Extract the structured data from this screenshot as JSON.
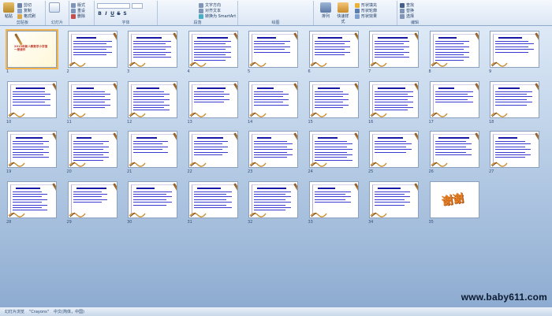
{
  "ribbon": {
    "clipboard": {
      "paste": "粘贴",
      "cut": "剪切",
      "copy": "复制",
      "format_painter": "格式刷",
      "group": "剪贴板"
    },
    "slides": {
      "new_slide": "新建\n幻灯片",
      "layout": "版式",
      "reset": "重设",
      "delete": "删除",
      "group": "幻灯片"
    },
    "font": {
      "group": "字体",
      "bold": "B",
      "italic": "I",
      "underline": "U",
      "strike": "S",
      "shadow": "S"
    },
    "paragraph": {
      "group": "段落",
      "text_direction": "文字方向",
      "align_text": "对齐文本",
      "smartart": "转换为 SmartArt"
    },
    "drawing": {
      "group": "绘图",
      "arrange": "排列",
      "quick_styles": "快速样式",
      "fill": "形状填充",
      "outline": "形状轮廓",
      "effects": "形状效果"
    },
    "editing": {
      "group": "编辑",
      "find": "查找",
      "replace": "替换",
      "select": "选择"
    }
  },
  "slides": [
    {
      "num": "1",
      "kind": "title",
      "text": "2013年新人教数学小学第一册课件",
      "selected": true
    },
    {
      "num": "2"
    },
    {
      "num": "3"
    },
    {
      "num": "4"
    },
    {
      "num": "5"
    },
    {
      "num": "6"
    },
    {
      "num": "7"
    },
    {
      "num": "8"
    },
    {
      "num": "9"
    },
    {
      "num": "10"
    },
    {
      "num": "11"
    },
    {
      "num": "12"
    },
    {
      "num": "13"
    },
    {
      "num": "14"
    },
    {
      "num": "15"
    },
    {
      "num": "16"
    },
    {
      "num": "17"
    },
    {
      "num": "18"
    },
    {
      "num": "19"
    },
    {
      "num": "20"
    },
    {
      "num": "21"
    },
    {
      "num": "22"
    },
    {
      "num": "23"
    },
    {
      "num": "24"
    },
    {
      "num": "25"
    },
    {
      "num": "26"
    },
    {
      "num": "27"
    },
    {
      "num": "28"
    },
    {
      "num": "29"
    },
    {
      "num": "30"
    },
    {
      "num": "31"
    },
    {
      "num": "32"
    },
    {
      "num": "33"
    },
    {
      "num": "34"
    },
    {
      "num": "35",
      "kind": "thanks",
      "text": "谢谢"
    }
  ],
  "watermark": "www.baby611.com",
  "status": {
    "slide_info": "幻灯片浏览",
    "theme": "\"Crayons\"",
    "language": "中文(简体，中国)"
  },
  "colors": {
    "selected_outline": "#f2b34d",
    "workspace_top": "#dde9f6",
    "workspace_bottom": "#8eacd1",
    "slide_text": "#1818a8"
  }
}
